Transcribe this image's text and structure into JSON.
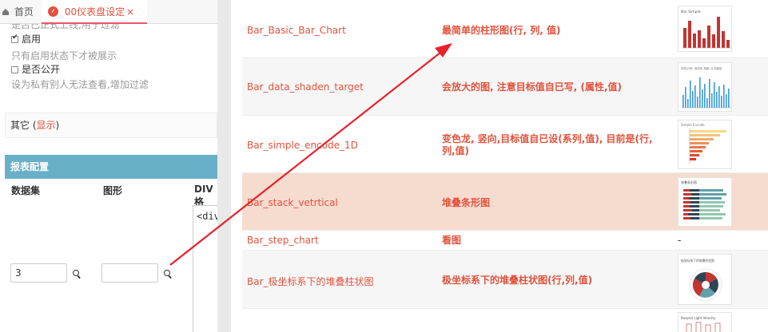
{
  "tabs": {
    "home_label": "首页",
    "dashboard_label": "00仪表盘设定",
    "close_glyph": "×"
  },
  "settings": {
    "truncated_hint": "是否已正式上线,用于过滤",
    "enable_label": "启用",
    "enable_hint": "只有启用状态下才被展示",
    "public_label": "是否公开",
    "public_hint": "设为私有别人无法查看,增加过滤"
  },
  "other": {
    "label": "其它 (",
    "link": "显示",
    "close": ")"
  },
  "report_config": {
    "title": "报表配置",
    "columns": [
      "数据集",
      "图形",
      "DIV格"
    ],
    "dataset_value": "3",
    "chart_value": "",
    "div_text": "<div"
  },
  "chart_list": [
    {
      "name": "Bar_Basic_Bar_Chart",
      "desc": "最简单的柱形图(行, 列, 值)",
      "thumb_title": "Bar Simple",
      "thumb": "bar-red"
    },
    {
      "name": "Bar_data_shaden_target",
      "desc": "会放大的图, 注意目标值自已写, (属性,值)",
      "thumb_title": "特性示例: 渐变色 阴影 点击缩放",
      "thumb": "bar-blue"
    },
    {
      "name": "Bar_simple_encode_1D",
      "desc": "变色龙, 竖向,目标值自已设(系列,值), 目前是(行,列,值)",
      "thumb_title": "Simple Encode",
      "thumb": "hbar-color"
    },
    {
      "name": "Bar_stack_vetrtical",
      "desc": "堆叠条形图",
      "thumb_title": "堆叠条形图",
      "thumb": "stack-bar"
    },
    {
      "name": "Bar_step_chart",
      "desc": "看图",
      "thumb_title": "-",
      "thumb": "none"
    },
    {
      "name": "Bar_极坐标系下的堆叠柱状图",
      "desc": "极坐标系下的堆叠柱状图(行,列,值)",
      "thumb_title": "极坐标系下的堆叠柱状图",
      "thumb": "polar"
    },
    {
      "name": "",
      "desc": "",
      "thumb_title": "Boxplot Light Velocity",
      "thumb": "box"
    }
  ],
  "colors": {
    "accent": "#e2523c",
    "header_blue": "#67b0c8",
    "highlight_row": "#f6dccf",
    "arrow": "#e8202a"
  }
}
